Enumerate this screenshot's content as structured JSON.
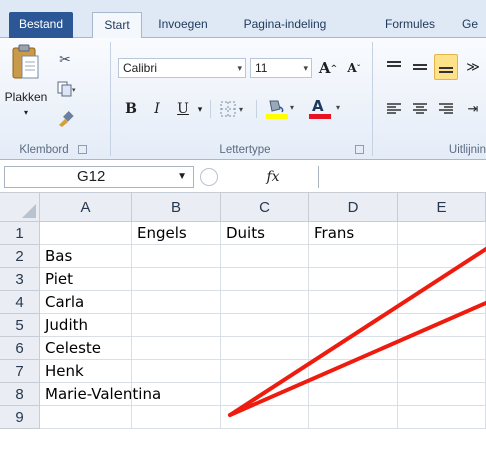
{
  "tabs": [
    {
      "label": "Bestand",
      "kind": "file"
    },
    {
      "label": "Start",
      "kind": "active"
    },
    {
      "label": "Invoegen",
      "kind": "normal"
    },
    {
      "label": "Pagina-indeling",
      "kind": "normal"
    },
    {
      "label": "Formules",
      "kind": "normal"
    },
    {
      "label": "Ge",
      "kind": "normal"
    }
  ],
  "ribbon": {
    "clipboard": {
      "paste_label": "Plakken",
      "group_label": "Klembord"
    },
    "font": {
      "font_name": "Calibri",
      "font_size": "11",
      "bold": "B",
      "italic": "I",
      "underline": "U",
      "font_color_letter": "A",
      "grow_letter": "A",
      "shrink_letter": "A",
      "group_label": "Lettertype",
      "highlight_color": "#ffff00",
      "font_color": "#e81123"
    },
    "alignment": {
      "group_label": "Uitlijnin"
    }
  },
  "formula_bar": {
    "name_box": "G12",
    "fx": "fx",
    "formula": ""
  },
  "sheet": {
    "columns": [
      "A",
      "B",
      "C",
      "D",
      "E"
    ],
    "rows": [
      "1",
      "2",
      "3",
      "4",
      "5",
      "6",
      "7",
      "8",
      "9"
    ],
    "cells": [
      [
        "",
        "Engels",
        "Duits",
        "Frans",
        ""
      ],
      [
        "Bas",
        "",
        "",
        "",
        ""
      ],
      [
        "Piet",
        "",
        "",
        "",
        ""
      ],
      [
        "Carla",
        "",
        "",
        "",
        ""
      ],
      [
        "Judith",
        "",
        "",
        "",
        ""
      ],
      [
        "Celeste",
        "",
        "",
        "",
        ""
      ],
      [
        "Henk",
        "",
        "",
        "",
        ""
      ],
      [
        "Marie-Valentina",
        "",
        "",
        "",
        ""
      ],
      [
        "",
        "",
        "",
        "",
        ""
      ]
    ]
  },
  "annotation": {
    "color": "#ee1c0e"
  }
}
